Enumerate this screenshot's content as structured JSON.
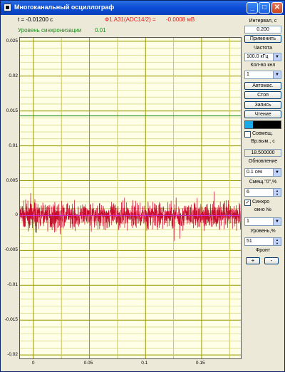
{
  "window": {
    "title": "Многоканальный осциллограф",
    "icons": [
      "app-icon",
      "minimize-icon",
      "maximize-icon",
      "close-icon"
    ],
    "minimize_glyph": "_",
    "maximize_glyph": "□",
    "close_glyph": "✕"
  },
  "readout": {
    "time_text": "t = -0.01200 c",
    "channel_text": "Ф1.А31(ADC14/2) =",
    "channel_value": "-0.0008 мВ",
    "sync_label": "Уровень синхронизации",
    "sync_value": "0.01",
    "colors": {
      "time": "#000000",
      "channel": "#e0201a",
      "sync": "#1a8c1a"
    }
  },
  "panel": {
    "interval_label": "Интервал, с",
    "interval_value": "0.200",
    "apply_button": "Применить",
    "frequency_label": "Частота",
    "frequency_value": "100.0 кГц",
    "channels_label": "Кол-во кнл",
    "channels_value": "1",
    "auto_button": "Автомас.",
    "stop_button": "Стоп",
    "record_button": "Запись",
    "read_button": "Чтение",
    "meter_level": 0.22,
    "combine_label": "Совмещ.",
    "time_label": "Вр.вым., с",
    "time_value": "18.500000",
    "update_label": "Обновление",
    "update_value": "0.1 сек",
    "offset_label": "Смещ.\"0\",%",
    "offset_value": "6",
    "sync_checkbox_label": "Синхро",
    "sync_checked": true,
    "window_label": "окно №",
    "window_value": "1",
    "level_label": "Уровень,%",
    "level_value": "51",
    "front_label": "Фронт",
    "plus_button": "+",
    "minus_button": "-"
  },
  "chart_data": {
    "type": "line",
    "title": "",
    "xlabel": "",
    "ylabel": "",
    "xlim": [
      -0.012,
      0.185
    ],
    "ylim": [
      -0.0205,
      0.0255
    ],
    "x_ticks": [
      "0",
      "0.05",
      "0.1",
      "0.15"
    ],
    "x_tick_values": [
      0,
      0.05,
      0.1,
      0.15
    ],
    "y_ticks": [
      "0.025",
      "0.02",
      "0.015",
      "0.01",
      "0.005",
      "0",
      "-0.005",
      "-0.01",
      "-0.015",
      "-0.02"
    ],
    "y_tick_values": [
      0.025,
      0.02,
      0.015,
      0.01,
      0.005,
      0,
      -0.005,
      -0.01,
      -0.015,
      -0.02
    ],
    "grid": true,
    "series": [
      {
        "color": "#c8102e",
        "center": 0,
        "noise_amplitude": 0.0028,
        "x_range": [
          -0.012,
          0.185
        ]
      }
    ],
    "sync_level_line": {
      "value": 0.0143,
      "color": "#1a8c1a"
    },
    "colors": {
      "background": "#ffffe8",
      "grid_major": "#9a9a00",
      "grid_minor": "#c8c860",
      "trace": "#c8102e",
      "zero_line": "#cc33cc"
    }
  }
}
